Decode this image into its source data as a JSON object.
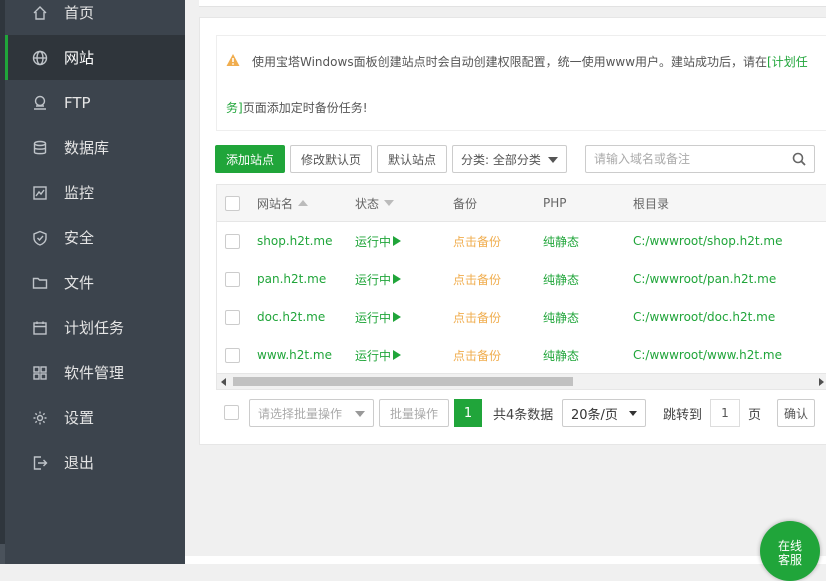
{
  "sidebar": {
    "items": [
      {
        "label": "首页",
        "icon": "home-icon"
      },
      {
        "label": "网站",
        "icon": "globe-icon",
        "active": true
      },
      {
        "label": "FTP",
        "icon": "ftp-icon"
      },
      {
        "label": "数据库",
        "icon": "database-icon"
      },
      {
        "label": "监控",
        "icon": "monitor-icon"
      },
      {
        "label": "安全",
        "icon": "shield-icon"
      },
      {
        "label": "文件",
        "icon": "folder-icon"
      },
      {
        "label": "计划任务",
        "icon": "calendar-icon"
      },
      {
        "label": "软件管理",
        "icon": "apps-icon"
      },
      {
        "label": "设置",
        "icon": "gear-icon"
      },
      {
        "label": "退出",
        "icon": "logout-icon"
      }
    ]
  },
  "notice": {
    "text1": "使用宝塔Windows面板创建站点时会自动创建权限配置，统一使用www用户。建站成功后，请在",
    "link1": "[计划任",
    "link2": "务]",
    "text2": "页面添加定时备份任务!"
  },
  "toolbar": {
    "add_site": "添加站点",
    "edit_default_page": "修改默认页",
    "default_site": "默认站点",
    "category": "分类: 全部分类",
    "search_placeholder": "请输入域名或备注"
  },
  "table": {
    "headers": {
      "name": "网站名",
      "status": "状态",
      "backup": "备份",
      "php": "PHP",
      "root": "根目录"
    },
    "rows": [
      {
        "name": "shop.h2t.me",
        "status": "运行中",
        "backup": "点击备份",
        "php": "纯静态",
        "root": "C:/wwwroot/shop.h2t.me"
      },
      {
        "name": "pan.h2t.me",
        "status": "运行中",
        "backup": "点击备份",
        "php": "纯静态",
        "root": "C:/wwwroot/pan.h2t.me"
      },
      {
        "name": "doc.h2t.me",
        "status": "运行中",
        "backup": "点击备份",
        "php": "纯静态",
        "root": "C:/wwwroot/doc.h2t.me"
      },
      {
        "name": "www.h2t.me",
        "status": "运行中",
        "backup": "点击备份",
        "php": "纯静态",
        "root": "C:/wwwroot/www.h2t.me"
      }
    ]
  },
  "footer": {
    "batch_select_placeholder": "请选择批量操作",
    "batch_button": "批量操作",
    "current_page": "1",
    "total": "共4条数据",
    "per_page": "20条/页",
    "jump_label": "跳转到",
    "jump_value": "1",
    "page_unit": "页",
    "confirm": "确认"
  },
  "online_service": {
    "line1": "在线",
    "line2": "客服"
  },
  "colors": {
    "accent": "#20a53a",
    "sidebar": "#3c444d",
    "backup_link": "#f0ad4e"
  }
}
